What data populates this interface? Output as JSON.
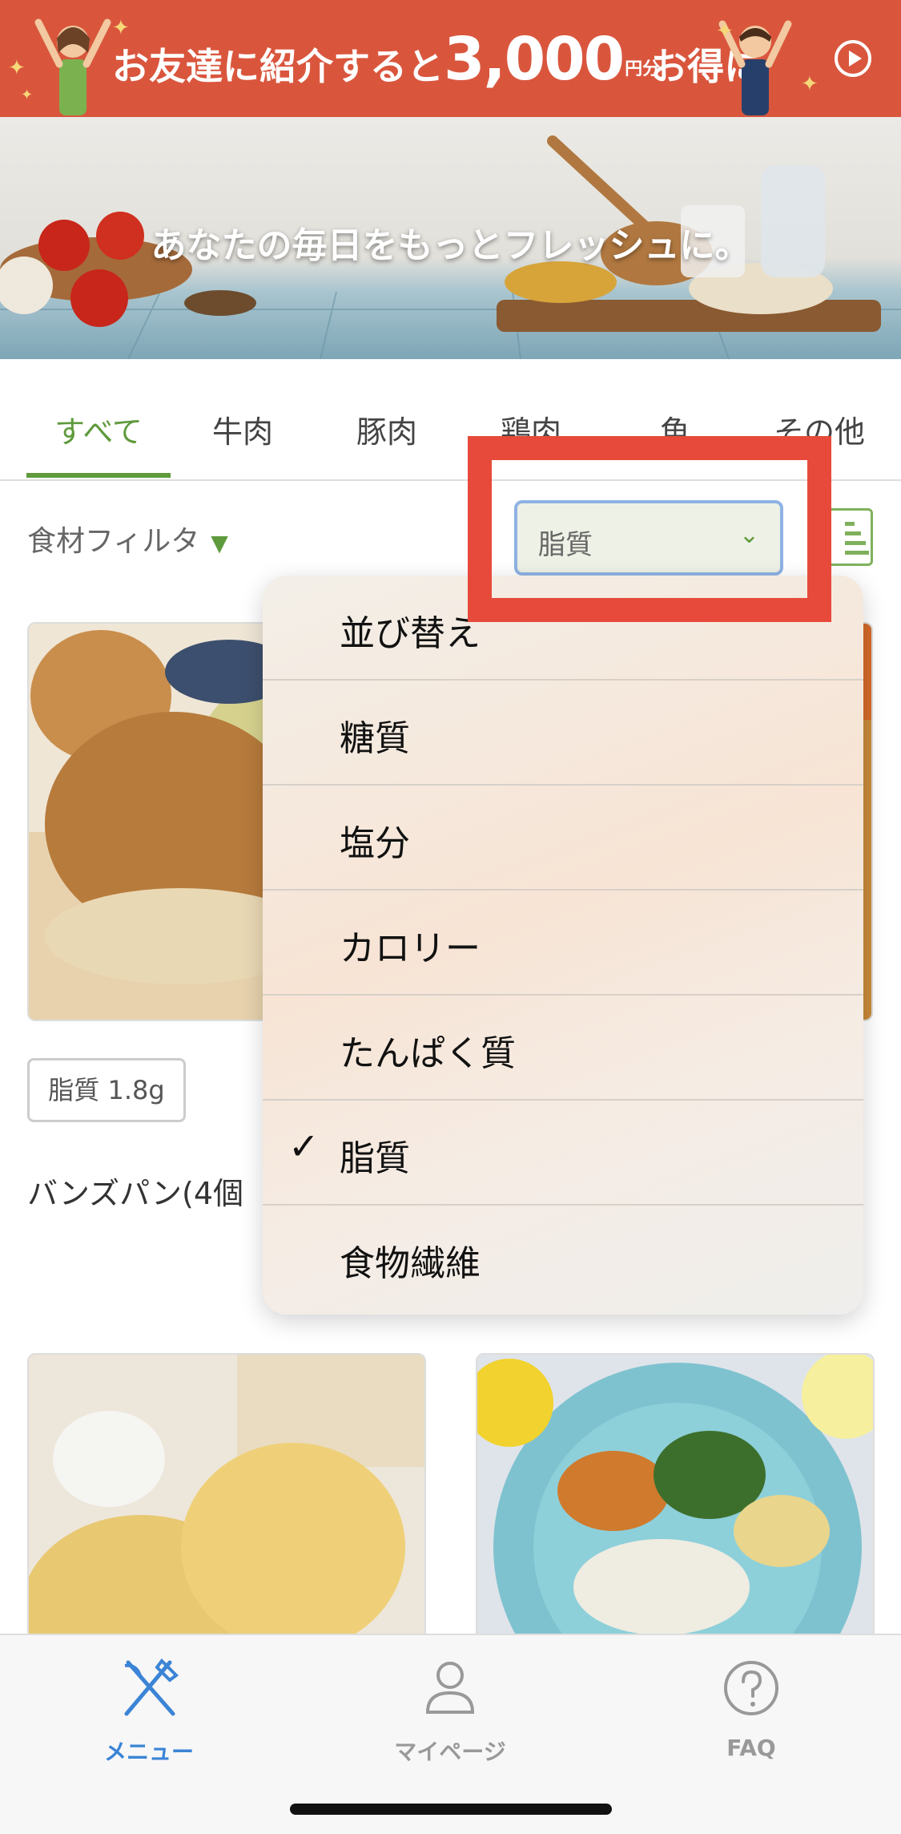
{
  "banner": {
    "text_before": "お友達に紹介すると",
    "amount": "3,000",
    "yen_unit": "円分",
    "text_after": "お得に"
  },
  "hero": {
    "headline": "あなたの毎日をもっとフレッシュに。"
  },
  "tabs": [
    {
      "label": "すべて"
    },
    {
      "label": "牛肉"
    },
    {
      "label": "豚肉"
    },
    {
      "label": "鶏肉"
    },
    {
      "label": "魚"
    },
    {
      "label": "その他"
    }
  ],
  "filter": {
    "label": "食材フィルタ",
    "sort_value": "脂質"
  },
  "sort_menu": {
    "items": [
      {
        "label": "並び替え",
        "selected": false
      },
      {
        "label": "糖質",
        "selected": false
      },
      {
        "label": "塩分",
        "selected": false
      },
      {
        "label": "カロリー",
        "selected": false
      },
      {
        "label": "たんぱく質",
        "selected": false
      },
      {
        "label": "脂質",
        "selected": true,
        "check": "✓"
      },
      {
        "label": "食物繊維",
        "selected": false
      }
    ]
  },
  "product": {
    "nutrition_badge": "脂質 1.8g",
    "name": "バンズパン(4個"
  },
  "bottom_nav": {
    "items": [
      {
        "label": "メニュー",
        "icon": "fork-knife-icon",
        "active": true
      },
      {
        "label": "マイページ",
        "icon": "person-icon",
        "active": false
      },
      {
        "label": "FAQ",
        "icon": "question-circle-icon",
        "active": false
      }
    ]
  },
  "colors": {
    "banner": "#d9563d",
    "accent_green": "#5f9a3c",
    "highlight_red": "#e74a3a",
    "nav_active_blue": "#3b84d6"
  }
}
